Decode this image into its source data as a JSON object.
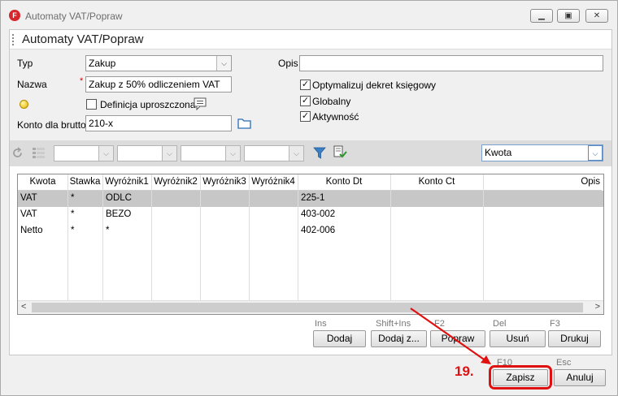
{
  "window": {
    "title": "Automaty VAT/Popraw",
    "app_icon_letter": "F",
    "controls": [
      "minimize",
      "restore",
      "close"
    ]
  },
  "panel": {
    "title": "Automaty VAT/Popraw"
  },
  "form": {
    "typ_label": "Typ",
    "typ_value": "Zakup",
    "nazwa_label": "Nazwa",
    "nazwa_required": "*",
    "nazwa_value": "Zakup z 50% odliczeniem VAT",
    "definicja_label": "Definicja uproszczona",
    "definicja_checked": false,
    "konto_label": "Konto dla brutto",
    "konto_value": "210-x",
    "opis_label": "Opis",
    "opis_value": "",
    "checks": [
      {
        "label": "Optymalizuj dekret księgowy",
        "checked": true
      },
      {
        "label": "Globalny",
        "checked": true
      },
      {
        "label": "Aktywność",
        "checked": true
      }
    ]
  },
  "toolbar": {
    "filter_value": "Kwota"
  },
  "grid": {
    "columns": [
      "Kwota",
      "Stawka",
      "Wyróżnik1",
      "Wyróżnik2",
      "Wyróżnik3",
      "Wyróżnik4",
      "Konto Dt",
      "Konto Ct",
      "Opis"
    ],
    "rows": [
      [
        "VAT",
        "*",
        "ODLC",
        "",
        "",
        "",
        "225-1",
        "",
        ""
      ],
      [
        "VAT",
        "*",
        "BEZO",
        "",
        "",
        "",
        "403-002",
        "",
        ""
      ],
      [
        "Netto",
        "*",
        "*",
        "",
        "",
        "",
        "402-006",
        "",
        ""
      ]
    ],
    "selected_row": 0
  },
  "actions": [
    {
      "shortcut": "Ins",
      "label": "Dodaj"
    },
    {
      "shortcut": "Shift+Ins",
      "label": "Dodaj z..."
    },
    {
      "shortcut": "F2",
      "label": "Popraw"
    },
    {
      "shortcut": "Del",
      "label": "Usuń"
    },
    {
      "shortcut": "F3",
      "label": "Drukuj"
    }
  ],
  "footer": {
    "save_shortcut": "F10",
    "save_label": "Zapisz",
    "cancel_shortcut": "Esc",
    "cancel_label": "Anuluj"
  },
  "annotation": {
    "step": "19.",
    "color": "#e01010"
  }
}
